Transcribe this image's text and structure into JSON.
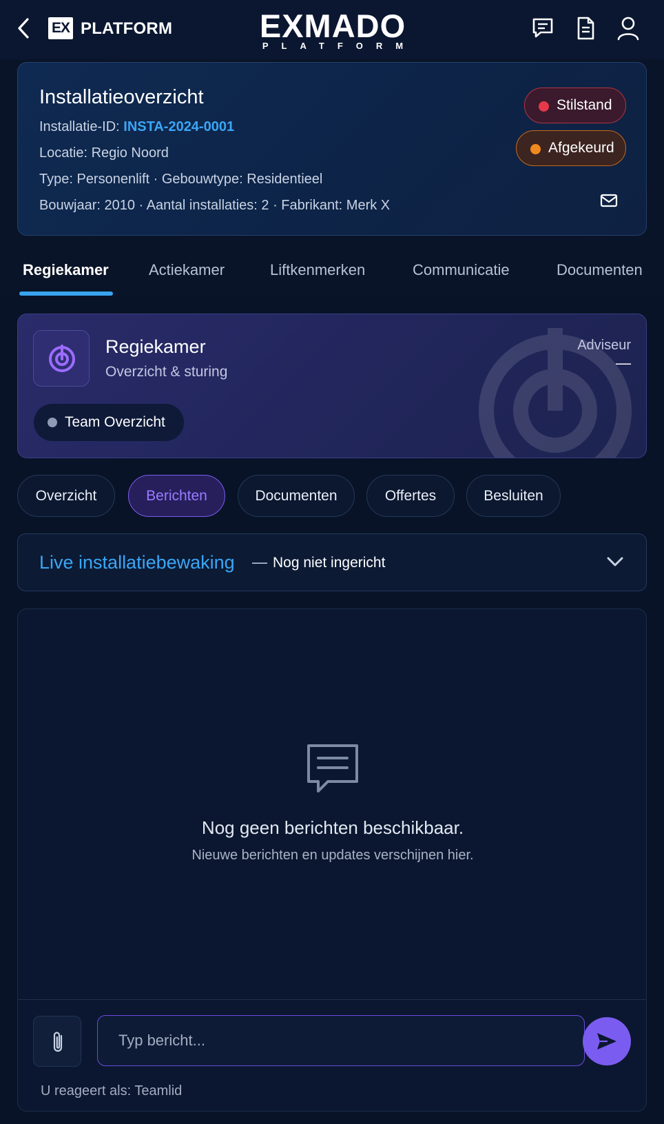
{
  "header": {
    "back_icon": "chevron-left-icon",
    "badge": "EX",
    "brand": "PLATFORM",
    "logo_main": "EXMADO",
    "logo_sub": "PLATFORM",
    "icons": [
      "chat-icon",
      "document-icon",
      "user-icon"
    ]
  },
  "installation": {
    "title": "Installatieoverzicht",
    "id_label": "Installatie-ID: ",
    "id_value": "INSTA-2024-0001",
    "location": "Locatie: Regio Noord",
    "type_line": "Type: Personenlift · Gebouwtype: Residentieel",
    "meta_line": "Bouwjaar: 2010 · Aantal installaties: 2 · Fabrikant: Merk X",
    "status_primary": "Stilstand",
    "status_secondary": "Afgekeurd",
    "colors": {
      "status_red": "#e5394a",
      "status_orange": "#f08a1c"
    }
  },
  "tabs": [
    "Regiekamer",
    "Actiekamer",
    "Liftkenmerken",
    "Communicatie",
    "Documenten"
  ],
  "regiekamer": {
    "title": "Regiekamer",
    "subtitle": "Overzicht & sturing",
    "role_label": "Adviseur",
    "role_value": "—",
    "team_label": "Team Overzicht"
  },
  "subtabs": [
    "Overzicht",
    "Berichten",
    "Documenten",
    "Offertes",
    "Besluiten"
  ],
  "live": {
    "title": "Live installatiebewaking",
    "separator": "—",
    "status": "Nog niet ingericht"
  },
  "messages": {
    "empty_title": "Nog geen berichten beschikbaar.",
    "empty_subtitle": "Nieuwe berichten en updates verschijnen hier.",
    "input_placeholder": "Typ bericht...",
    "reply_as": "U reageert als: Teamlid"
  },
  "colors": {
    "accent_blue": "#3ba6f5",
    "accent_purple": "#7b5cf0"
  }
}
